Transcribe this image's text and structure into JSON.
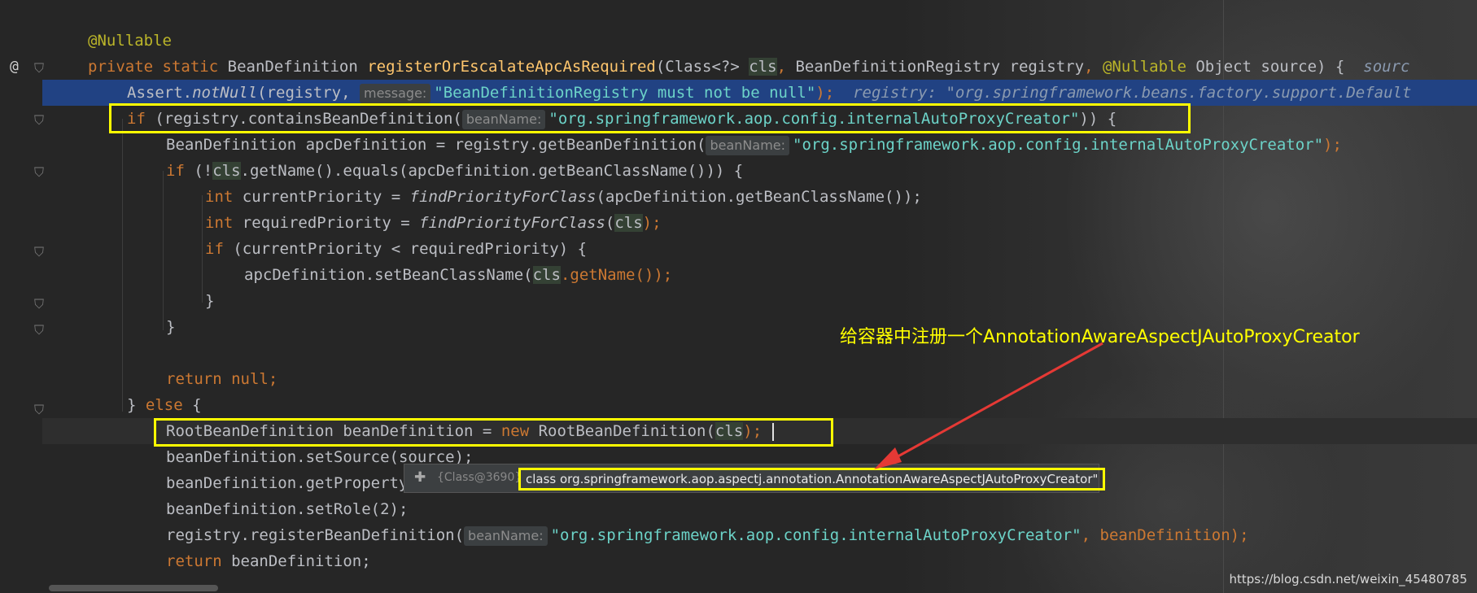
{
  "colors": {
    "keyword": "#cc7832",
    "method": "#ffc66d",
    "string": "#6aab73",
    "annotation": "#bbb529",
    "highlight_box": "#ffff00",
    "arrow": "#e53935"
  },
  "gutter": {
    "at_icon": "@",
    "bulb_icon": "lightbulb-icon",
    "fold_icon": "fold-icon"
  },
  "code": {
    "annotation": "@Nullable",
    "signature": {
      "kw_private": "private",
      "kw_static": "static",
      "return_type": "BeanDefinition",
      "method_name": "registerOrEscalateApcAsRequired",
      "params_a": "(Class<?> ",
      "param_cls": "cls",
      "comma_a": ", ",
      "params_b": "BeanDefinitionRegistry registry",
      "comma_b": ", ",
      "nullable": "@Nullable",
      "params_c": " Object source) {",
      "inline_hint": "sourc"
    },
    "assert_line": {
      "call_a": "Assert.",
      "call_b": "notNull",
      "call_c": "(registry, ",
      "hint": "message:",
      "str": "\"BeanDefinitionRegistry must not be null\"",
      "end": ");",
      "inline_val": "registry: \"org.springframework.beans.factory.support.Default"
    },
    "if_line": {
      "kw_if": "if",
      "call": " (registry.containsBeanDefinition(",
      "hint": "beanName:",
      "str": "\"org.springframework.aop.config.internalAutoProxyCreator\"",
      "end": ")) {"
    },
    "apc_line": {
      "text": "BeanDefinition apcDefinition = registry.getBeanDefinition(",
      "hint": "beanName:",
      "str": "\"org.springframework.aop.config.internalAutoProxyCreator\"",
      "end": ");"
    },
    "if_cls_line": {
      "kw_if": "if",
      "a": " (!",
      "cls": "cls",
      "b": ".getName().equals(apcDefinition.getBeanClassName())) {"
    },
    "current_priority_line": {
      "kw_int": "int",
      "a": " currentPriority = ",
      "fn": "findPriorityForClass",
      "b": "(apcDefinition.getBeanClassName());"
    },
    "required_priority_line": {
      "kw_int": "int",
      "a": " requiredPriority = ",
      "fn": "findPriorityForClass",
      "b": "(",
      "cls": "cls",
      "c": ");"
    },
    "if_priority_line": {
      "kw_if": "if",
      "a": " (currentPriority < requiredPriority) {"
    },
    "set_class_line": {
      "a": "apcDefinition.setBeanClassName(",
      "cls": "cls",
      "b": ".getName());"
    },
    "close_brace_inner": "}",
    "close_brace_outer": "}",
    "return_null": {
      "kw": "return",
      "val": " null;"
    },
    "else_line": {
      "a": "} ",
      "kw": "else",
      "b": " {"
    },
    "root_def_line": {
      "a": "RootBeanDefinition beanDefinition = ",
      "kw_new": "new",
      "b": " RootBeanDefinition(",
      "cls": "cls",
      "c": ");"
    },
    "set_source_line": "beanDefinition.setSource(source);",
    "get_property_line": "beanDefinition.getPropertyValues().add(\"order\", Ordered.HIGHEST_PRECEDENCE);",
    "set_role_line": "beanDefinition.setRole(2);",
    "register_line": {
      "a": "registry.registerBeanDefinition(",
      "hint": "beanName:",
      "str": "\"org.springframework.aop.config.internalAutoProxyCreator\"",
      "end": ", beanDefinition);"
    },
    "return_def_line": {
      "kw": "return",
      "val": " beanDefinition;"
    }
  },
  "debug_popup": {
    "expand_icon": "plus-icon",
    "ref": "{Class@3690}",
    "value": "class org.springframework.aop.aspectj.annotation.AnnotationAwareAspectJAutoProxyCreator\""
  },
  "annotation_text": "给容器中注册一个AnnotationAwareAspectJAutoProxyCreator",
  "watermark": "https://blog.csdn.net/weixin_45480785"
}
